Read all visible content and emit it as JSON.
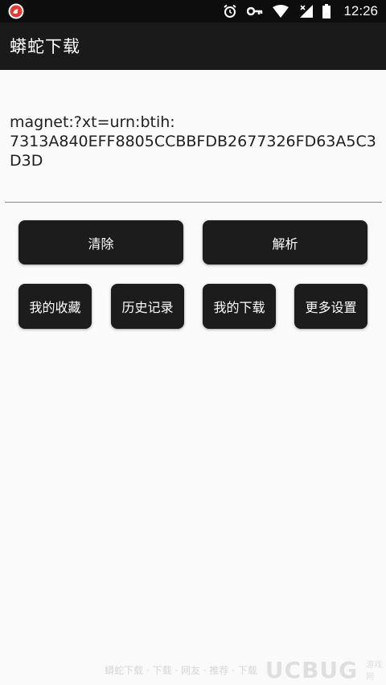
{
  "status_bar": {
    "time": "12:26",
    "icons": [
      "app-notification-icon",
      "alarm-icon",
      "key-icon",
      "wifi-icon",
      "signal-icon",
      "battery-icon"
    ]
  },
  "app_bar": {
    "title": "蟒蛇下载"
  },
  "magnet_input": {
    "value": "magnet:?xt=urn:btih:\n7313A840EFF8805CCBBFDB2677326FD63A5C3D3D"
  },
  "buttons": {
    "clear": "清除",
    "parse": "解析",
    "favorites": "我的收藏",
    "history": "历史记录",
    "downloads": "我的下载",
    "settings": "更多设置"
  },
  "watermark": {
    "text": "蟒蛇下载 · 下载 · 网友 · 推荐 · 下载",
    "logo": "UCBUG",
    "suffix": "游戏网"
  },
  "colors": {
    "status_bar": "#0d0d0d",
    "app_bar": "#1a1a1a",
    "button": "#1c1c1c",
    "background": "#fafafa",
    "accent_icon": "#e53935"
  }
}
